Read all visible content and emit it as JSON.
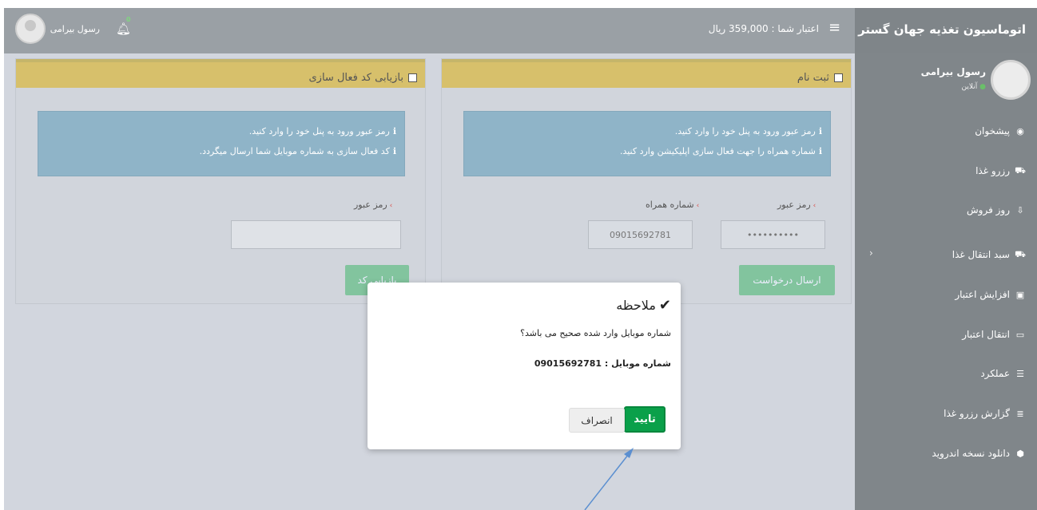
{
  "header": {
    "brand": "اتوماسیون تغذیه جهان گستر",
    "menu_icon": "hamburger-icon",
    "credit_label": "اعتبار شما : 359,000 ریال",
    "notification_count": "0",
    "user_name": "رسول بیرامی"
  },
  "sidebar": {
    "user_name": "رسول بیرامی",
    "status": "آنلاین",
    "items": [
      {
        "label": "پیشخوان",
        "icon": "dashboard-icon"
      },
      {
        "label": "رزرو غذا",
        "icon": "cart-icon"
      },
      {
        "label": "روز فروش",
        "icon": "download-icon"
      },
      {
        "label": "سبد انتقال غذا",
        "icon": "cart-icon"
      },
      {
        "label": "افزایش اعتبار",
        "icon": "money-icon"
      },
      {
        "label": "انتقال اعتبار",
        "icon": "credit-card-icon"
      },
      {
        "label": "عملکرد",
        "icon": "server-icon"
      },
      {
        "label": "گزارش رزرو غذا",
        "icon": "list-icon"
      },
      {
        "label": "دانلود نسخه اندروید",
        "icon": "android-icon"
      }
    ]
  },
  "register_panel": {
    "title": "ثبت نام",
    "info_line1": "رمز عبور ورود به پنل خود را وارد کنید.",
    "info_line2": "شماره همراه را جهت فعال سازی اپلیکیشن وارد کنید.",
    "password_label": "رمز عبور",
    "password_value": "••••••••••",
    "mobile_label": "شماره همراه",
    "mobile_value": "09015692781",
    "submit_label": "ارسال درخواست"
  },
  "recover_panel": {
    "title": "بازیابی کد فعال سازی",
    "info_line1": "رمز عبور ورود به پنل خود را وارد کنید.",
    "info_line2": "کد فعال سازی به شماره موبایل شما ارسال میگردد.",
    "password_label": "رمز عبور",
    "password_value": "",
    "submit_label": "بازیابی کد"
  },
  "modal": {
    "title": "ملاحظه",
    "question": "شماره موبایل وارد شده صحیح می باشد؟",
    "mobile_line": "شماره موبایل : 09015692781",
    "ok_label": "تایید",
    "cancel_label": "انصراف"
  },
  "colors": {
    "header": "#9aa0a5",
    "sidebar": "#80868a",
    "panel_head": "#d7c06b",
    "info_box": "#8fb4c8",
    "ok_button": "#0aa04a",
    "arrow": "#5b8fd0"
  }
}
